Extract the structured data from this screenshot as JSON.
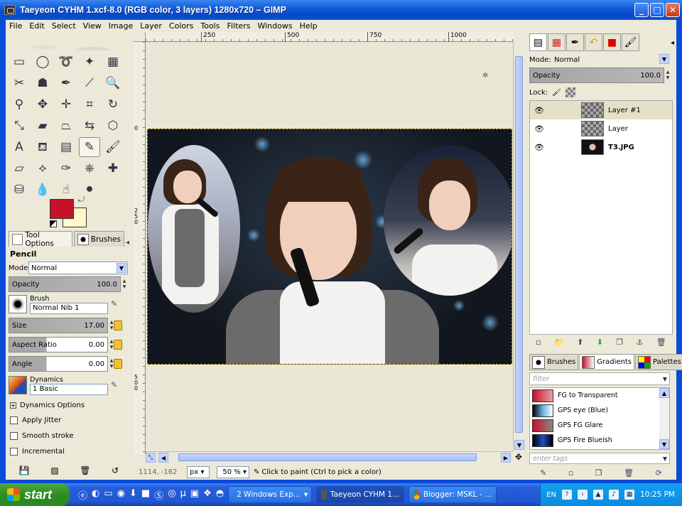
{
  "window": {
    "title": "Taeyeon CYHM 1.xcf-8.0 (RGB color, 3 layers) 1280x720 – GIMP",
    "buttons": {
      "minimize": "_",
      "maximize": "□",
      "close": "✕"
    }
  },
  "menu": [
    "File",
    "Edit",
    "Select",
    "View",
    "Image",
    "Layer",
    "Colors",
    "Tools",
    "Filters",
    "Windows",
    "Help"
  ],
  "toolbox": {
    "tools": [
      {
        "name": "rect-select-icon",
        "glyph": "▭"
      },
      {
        "name": "ellipse-select-icon",
        "glyph": "◯"
      },
      {
        "name": "free-select-icon",
        "glyph": "➰"
      },
      {
        "name": "fuzzy-select-icon",
        "glyph": "✦"
      },
      {
        "name": "color-select-icon",
        "glyph": "▦"
      },
      {
        "name": "scissors-icon",
        "glyph": "✂"
      },
      {
        "name": "foreground-select-icon",
        "glyph": "☗"
      },
      {
        "name": "paths-icon",
        "glyph": "✒"
      },
      {
        "name": "color-picker-icon",
        "glyph": "⟋"
      },
      {
        "name": "zoom-icon",
        "glyph": "🔍"
      },
      {
        "name": "measure-icon",
        "glyph": "⚲"
      },
      {
        "name": "move-icon",
        "glyph": "✥"
      },
      {
        "name": "align-icon",
        "glyph": "✛"
      },
      {
        "name": "crop-icon",
        "glyph": "⌗"
      },
      {
        "name": "rotate-icon",
        "glyph": "↻"
      },
      {
        "name": "scale-icon",
        "glyph": "⤡"
      },
      {
        "name": "shear-icon",
        "glyph": "▰"
      },
      {
        "name": "perspective-icon",
        "glyph": "⏢"
      },
      {
        "name": "flip-icon",
        "glyph": "⇆"
      },
      {
        "name": "cage-icon",
        "glyph": "⬡"
      },
      {
        "name": "text-icon",
        "glyph": "A"
      },
      {
        "name": "bucket-fill-icon",
        "glyph": "⛾"
      },
      {
        "name": "blend-icon",
        "glyph": "▤"
      },
      {
        "name": "pencil-icon",
        "glyph": "✎"
      },
      {
        "name": "paintbrush-icon",
        "glyph": "🖌"
      },
      {
        "name": "eraser-icon",
        "glyph": "▱"
      },
      {
        "name": "airbrush-icon",
        "glyph": "⟡"
      },
      {
        "name": "ink-icon",
        "glyph": "✑"
      },
      {
        "name": "clone-icon",
        "glyph": "⎈"
      },
      {
        "name": "heal-icon",
        "glyph": "✚"
      },
      {
        "name": "perspective-clone-icon",
        "glyph": "⛁"
      },
      {
        "name": "blur-icon",
        "glyph": "💧"
      },
      {
        "name": "smudge-icon",
        "glyph": "☝"
      },
      {
        "name": "dodge-burn-icon",
        "glyph": "⚫"
      }
    ],
    "active_tool_index": 23,
    "fg_color": "#c8102a",
    "bg_color": "#fff8c8"
  },
  "tool_options": {
    "tabs": [
      "Tool Options",
      "Brushes"
    ],
    "title": "Pencil",
    "mode_label": "Mode:",
    "mode_value": "Normal",
    "opacity_label": "Opacity",
    "opacity_value": "100.0",
    "brush_label": "Brush",
    "brush_value": "Normal Nib 1",
    "size_label": "Size",
    "size_value": "17.00",
    "aspect_label": "Aspect Ratio",
    "aspect_value": "0.00",
    "angle_label": "Angle",
    "angle_value": "0.00",
    "dynamics_label": "Dynamics",
    "dynamics_value": "1 Basic",
    "dynamics_options": "Dynamics Options",
    "apply_jitter": "Apply Jitter",
    "smooth_stroke": "Smooth stroke",
    "incremental": "Incremental"
  },
  "canvas": {
    "hruler_ticks": [
      "250",
      "500",
      "750",
      "1000"
    ],
    "vruler_ticks": [
      "0",
      "250",
      "500"
    ],
    "status_coords": "1114, -162",
    "unit": "px",
    "zoom": "50 %",
    "status_msg": "Click to paint (Ctrl to pick a color)"
  },
  "layers": {
    "mode_label": "Mode:",
    "mode_value": "Normal",
    "opacity_label": "Opacity",
    "opacity_value": "100.0",
    "lock_label": "Lock:",
    "items": [
      {
        "name": "Layer #1",
        "selected": true,
        "bold": false
      },
      {
        "name": "Layer",
        "selected": false,
        "bold": false
      },
      {
        "name": "T3.JPG",
        "selected": false,
        "bold": true
      }
    ]
  },
  "resources": {
    "tabs": [
      "Brushes",
      "Gradients",
      "Palettes"
    ],
    "filter_placeholder": "filter",
    "gradients": [
      {
        "name": "FG to Transparent",
        "colors": [
          "#c8102a",
          "#e8a0a8"
        ]
      },
      {
        "name": "GPS eye (Blue)",
        "colors": [
          "#000000",
          "#6ab0e0",
          "#ffffff"
        ]
      },
      {
        "name": "GPS FG Glare",
        "colors": [
          "#c8102a",
          "#888888"
        ]
      },
      {
        "name": "GPS Fire Blueish",
        "colors": [
          "#000000",
          "#2050c0",
          "#000000"
        ]
      }
    ],
    "tags_placeholder": "enter tags"
  },
  "taskbar": {
    "start": "start",
    "tasks": [
      {
        "label": "2 Windows Exp...",
        "icon": "folder"
      },
      {
        "label": "Taeyeon CYHM 1...",
        "icon": "gimp"
      },
      {
        "label": "Blogger: MSKL - ...",
        "icon": "chrome"
      }
    ],
    "lang": "EN",
    "clock": "10:25 PM"
  }
}
